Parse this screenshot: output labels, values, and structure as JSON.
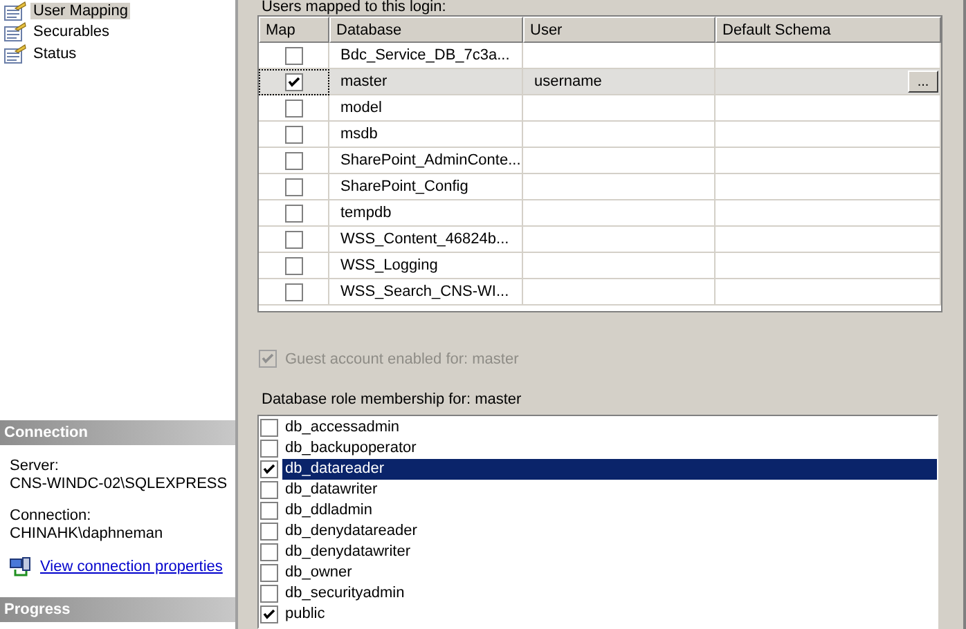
{
  "sidebar": {
    "items": [
      {
        "label": "User Mapping",
        "selected": true
      },
      {
        "label": "Securables",
        "selected": false
      },
      {
        "label": "Status",
        "selected": false
      }
    ]
  },
  "connection": {
    "header": "Connection",
    "server_label": "Server:",
    "server": "CNS-WINDC-02\\SQLEXPRESS",
    "connection_label": "Connection:",
    "connection": "CHINAHK\\daphneman",
    "link": "View connection properties"
  },
  "progress": {
    "header": "Progress"
  },
  "users_mapped": {
    "label": "Users mapped to this login:",
    "columns": [
      "Map",
      "Database",
      "User",
      "Default Schema"
    ],
    "rows": [
      {
        "map": false,
        "database": "Bdc_Service_DB_7c3a...",
        "selected": false
      },
      {
        "map": true,
        "database": "master",
        "user": "username",
        "browse_button": "...",
        "selected": true
      },
      {
        "map": false,
        "database": "model",
        "selected": false
      },
      {
        "map": false,
        "database": "msdb",
        "selected": false
      },
      {
        "map": false,
        "database": "SharePoint_AdminConte...",
        "selected": false
      },
      {
        "map": false,
        "database": "SharePoint_Config",
        "selected": false
      },
      {
        "map": false,
        "database": "tempdb",
        "selected": false
      },
      {
        "map": false,
        "database": "WSS_Content_46824b...",
        "selected": false
      },
      {
        "map": false,
        "database": "WSS_Logging",
        "selected": false
      },
      {
        "map": false,
        "database": "WSS_Search_CNS-WI...",
        "selected": false
      }
    ]
  },
  "guest_account": {
    "label": "Guest account enabled for: master",
    "checked": true,
    "disabled": true
  },
  "role_membership": {
    "label": "Database role membership for: master",
    "items": [
      {
        "name": "db_accessadmin",
        "checked": false,
        "selected": false
      },
      {
        "name": "db_backupoperator",
        "checked": false,
        "selected": false
      },
      {
        "name": "db_datareader",
        "checked": true,
        "selected": true
      },
      {
        "name": "db_datawriter",
        "checked": false,
        "selected": false
      },
      {
        "name": "db_ddladmin",
        "checked": false,
        "selected": false
      },
      {
        "name": "db_denydatareader",
        "checked": false,
        "selected": false
      },
      {
        "name": "db_denydatawriter",
        "checked": false,
        "selected": false
      },
      {
        "name": "db_owner",
        "checked": false,
        "selected": false
      },
      {
        "name": "db_securityadmin",
        "checked": false,
        "selected": false
      },
      {
        "name": "public",
        "checked": true,
        "selected": false
      }
    ]
  }
}
